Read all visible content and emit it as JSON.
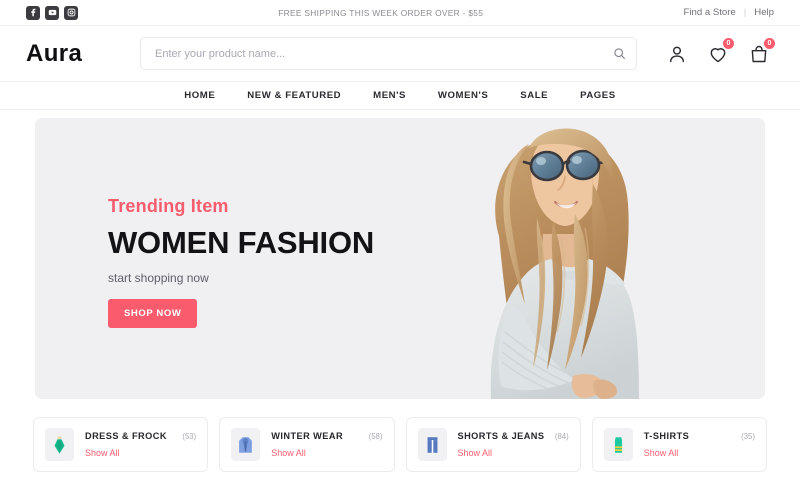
{
  "topbar": {
    "social": [
      {
        "name": "facebook-icon",
        "label": "Facebook"
      },
      {
        "name": "youtube-icon",
        "label": "YouTube"
      },
      {
        "name": "instagram-icon",
        "label": "Instagram"
      }
    ],
    "promo": "FREE SHIPPING THIS WEEK ORDER OVER - $55",
    "find_store": "Find a Store",
    "separator": "|",
    "help": "Help"
  },
  "header": {
    "logo": "Aura",
    "search": {
      "placeholder": "Enter your product name...",
      "value": "",
      "icon": "search-icon"
    },
    "actions": {
      "account_icon": "user-icon",
      "wishlist_icon": "heart-icon",
      "wishlist_count": "0",
      "cart_icon": "shopping-bag-icon",
      "cart_count": "0"
    }
  },
  "nav": {
    "items": [
      {
        "label": "HOME"
      },
      {
        "label": "NEW & FEATURED"
      },
      {
        "label": "MEN'S"
      },
      {
        "label": "WOMEN'S"
      },
      {
        "label": "SALE"
      },
      {
        "label": "PAGES"
      }
    ]
  },
  "hero": {
    "eyebrow": "Trending Item",
    "title": "WOMEN FASHION",
    "subtitle": "start shopping now",
    "cta": "SHOP NOW",
    "image_alt": "woman-with-sunglasses-photo"
  },
  "categories": [
    {
      "icon": "dress-icon",
      "title": "DRESS & FROCK",
      "count": "(53)",
      "link": "Show All"
    },
    {
      "icon": "coat-icon",
      "title": "WINTER WEAR",
      "count": "(58)",
      "link": "Show All"
    },
    {
      "icon": "jeans-icon",
      "title": "SHORTS & JEANS",
      "count": "(84)",
      "link": "Show All"
    },
    {
      "icon": "tshirt-icon",
      "title": "T-SHIRTS",
      "count": "(35)",
      "link": "Show All"
    }
  ],
  "colors": {
    "accent": "#fa5c6e",
    "hero_bg": "#f0f0f2",
    "text_dark": "#131317",
    "text_muted": "#8a8a92"
  }
}
